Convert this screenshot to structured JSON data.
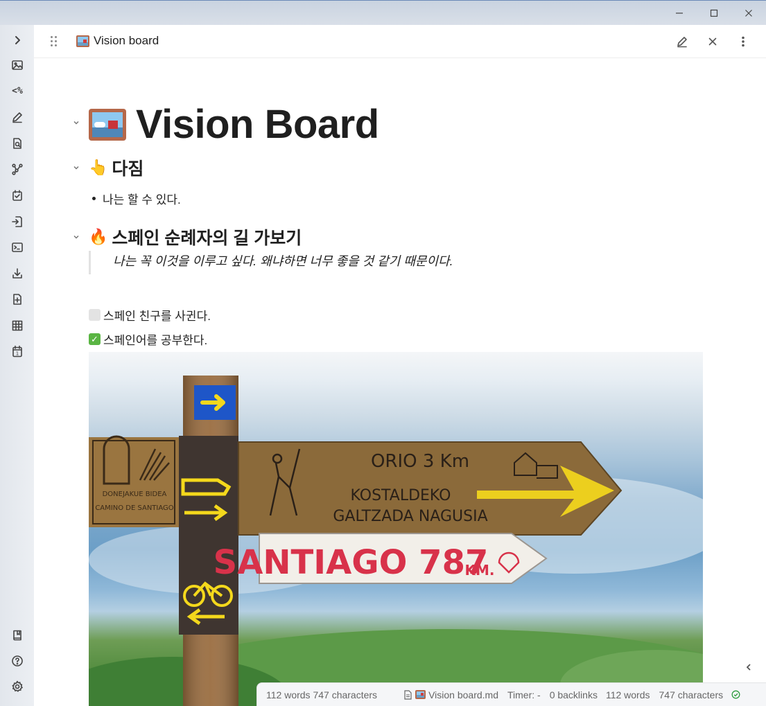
{
  "window": {
    "controls": [
      "–",
      "☐",
      "✕"
    ]
  },
  "ribbon": {
    "toggle_icon": "chevron-right-icon",
    "items": [
      "image-icon",
      "templater-icon",
      "pencil-icon",
      "file-search-icon",
      "graph-icon",
      "calendar-check-icon",
      "import-icon",
      "terminal-icon",
      "download-icon",
      "file-plus-icon",
      "table-icon",
      "daily-note-icon"
    ],
    "templater_label": "<%",
    "daily_number": "1",
    "bottom": [
      "vault-icon",
      "help-icon",
      "settings-icon"
    ]
  },
  "view_header": {
    "title": "Vision board",
    "actions": [
      "edit-icon",
      "close-icon",
      "more-options-icon"
    ]
  },
  "document": {
    "title": "Vision Board",
    "sections": [
      {
        "heading": "다짐",
        "emoji": "👆",
        "bullets": [
          "나는 할 수 있다."
        ]
      },
      {
        "heading": "스페인 순례자의 길 가보기",
        "emoji": "🔥",
        "quote": "나는 꼭 이것을 이루고 싶다. 왜냐하면 너무 좋을 것 같기 때문이다."
      }
    ],
    "tasks": [
      {
        "text": "스페인 친구를 사귄다.",
        "done": false
      },
      {
        "text": "스페인어를 공부한다.",
        "done": true
      }
    ],
    "image": {
      "sign_main_line1": "ORIO 3 Km",
      "sign_main_line2": "KOSTALDEKO",
      "sign_main_line3": "GALTZADA NAGUSIA",
      "sign_left_line1": "DONEJAKUE BIDEA",
      "sign_left_line2": "CAMINO DE SANTIAGO",
      "sign_red_text": "SANTIAGO 787",
      "sign_red_unit": "KM."
    }
  },
  "status_bar": {
    "selection_counts": "112 words 747 characters",
    "file_name": "Vision board.md",
    "timer": "Timer: -",
    "backlinks": "0 backlinks",
    "words": "112 words",
    "characters": "747 characters"
  },
  "colors": {
    "accent": "#6a8ab8",
    "sign_wood": "#8a6a3c",
    "sign_red": "#d8324a",
    "arrow_yellow": "#f4d81c",
    "sync_ok": "#2e9e3e"
  }
}
